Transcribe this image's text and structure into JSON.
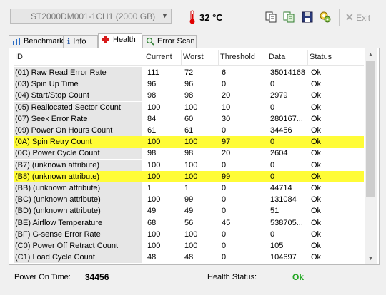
{
  "toolbar": {
    "drive": "ST2000DM001-1CH1 (2000 GB)",
    "temperature": "32 °C",
    "exit_label": "Exit",
    "icons": [
      "copy-icon",
      "copy-all-icon",
      "save-icon",
      "options-icon"
    ]
  },
  "tabs": [
    {
      "label": "Benchmark",
      "icon": "benchmark-icon"
    },
    {
      "label": "Info",
      "icon": "info-icon"
    },
    {
      "label": "Health",
      "icon": "health-icon",
      "active": true
    },
    {
      "label": "Error Scan",
      "icon": "magnifier-icon"
    }
  ],
  "table": {
    "columns": [
      "ID",
      "Current",
      "Worst",
      "Threshold",
      "Data",
      "Status"
    ],
    "rows": [
      {
        "id": "(01) Raw Read Error Rate",
        "current": "111",
        "worst": "72",
        "threshold": "6",
        "data": "35014168",
        "status": "Ok",
        "highlight": false
      },
      {
        "id": "(03) Spin Up Time",
        "current": "96",
        "worst": "96",
        "threshold": "0",
        "data": "0",
        "status": "Ok",
        "highlight": false
      },
      {
        "id": "(04) Start/Stop Count",
        "current": "98",
        "worst": "98",
        "threshold": "20",
        "data": "2979",
        "status": "Ok",
        "highlight": false
      },
      {
        "id": "(05) Reallocated Sector Count",
        "current": "100",
        "worst": "100",
        "threshold": "10",
        "data": "0",
        "status": "Ok",
        "highlight": false
      },
      {
        "id": "(07) Seek Error Rate",
        "current": "84",
        "worst": "60",
        "threshold": "30",
        "data": "280167...",
        "status": "Ok",
        "highlight": false
      },
      {
        "id": "(09) Power On Hours Count",
        "current": "61",
        "worst": "61",
        "threshold": "0",
        "data": "34456",
        "status": "Ok",
        "highlight": false
      },
      {
        "id": "(0A) Spin Retry Count",
        "current": "100",
        "worst": "100",
        "threshold": "97",
        "data": "0",
        "status": "Ok",
        "highlight": true
      },
      {
        "id": "(0C) Power Cycle Count",
        "current": "98",
        "worst": "98",
        "threshold": "20",
        "data": "2604",
        "status": "Ok",
        "highlight": false
      },
      {
        "id": "(B7) (unknown attribute)",
        "current": "100",
        "worst": "100",
        "threshold": "0",
        "data": "0",
        "status": "Ok",
        "highlight": false
      },
      {
        "id": "(B8) (unknown attribute)",
        "current": "100",
        "worst": "100",
        "threshold": "99",
        "data": "0",
        "status": "Ok",
        "highlight": true
      },
      {
        "id": "(BB) (unknown attribute)",
        "current": "1",
        "worst": "1",
        "threshold": "0",
        "data": "44714",
        "status": "Ok",
        "highlight": false
      },
      {
        "id": "(BC) (unknown attribute)",
        "current": "100",
        "worst": "99",
        "threshold": "0",
        "data": "131084",
        "status": "Ok",
        "highlight": false
      },
      {
        "id": "(BD) (unknown attribute)",
        "current": "49",
        "worst": "49",
        "threshold": "0",
        "data": "51",
        "status": "Ok",
        "highlight": false
      },
      {
        "id": "(BE) Airflow Temperature",
        "current": "68",
        "worst": "56",
        "threshold": "45",
        "data": "538705...",
        "status": "Ok",
        "highlight": false
      },
      {
        "id": "(BF) G-sense Error Rate",
        "current": "100",
        "worst": "100",
        "threshold": "0",
        "data": "0",
        "status": "Ok",
        "highlight": false
      },
      {
        "id": "(C0) Power Off Retract Count",
        "current": "100",
        "worst": "100",
        "threshold": "0",
        "data": "105",
        "status": "Ok",
        "highlight": false
      },
      {
        "id": "(C1) Load Cycle Count",
        "current": "48",
        "worst": "48",
        "threshold": "0",
        "data": "104697",
        "status": "Ok",
        "highlight": false
      }
    ]
  },
  "statusbar": {
    "power_on_label": "Power On Time:",
    "power_on_value": "34456",
    "health_label": "Health Status:",
    "health_value": "Ok"
  },
  "colors": {
    "highlight": "#fffc37",
    "ok_green": "#21a621"
  }
}
